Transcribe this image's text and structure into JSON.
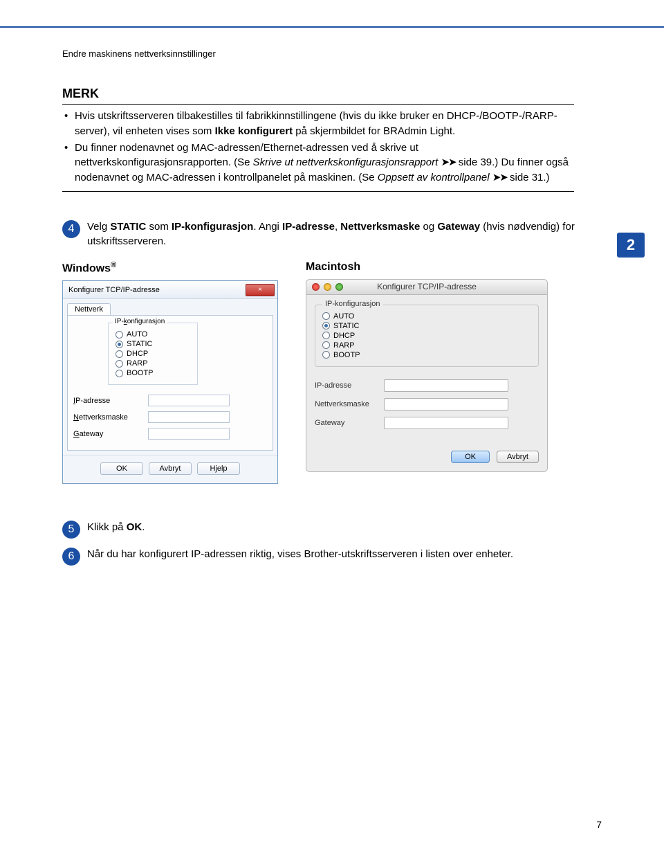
{
  "breadcrumb": "Endre maskinens nettverksinnstillinger",
  "chapter_badge": "2",
  "merk": {
    "title": "MERK",
    "bullet1_a": "Hvis utskriftsserveren tilbakestilles til fabrikkinnstillingene (hvis du ikke bruker en DHCP-/BOOTP-/RARP-server), vil enheten vises som ",
    "bullet1_b_bold": "Ikke konfigurert",
    "bullet1_c": " på skjermbildet for BRAdmin Light.",
    "bullet2_a": "Du finner nodenavnet og MAC-adressen/Ethernet-adressen ved å skrive ut nettverkskonfigurasjonsrapporten. (Se ",
    "bullet2_b_italic": "Skrive ut nettverkskonfigurasjonsrapport",
    "bullet2_c": " side 39.) Du finner også nodenavnet og MAC-adressen i kontrollpanelet på maskinen. (Se ",
    "bullet2_d_italic": "Oppsett av kontrollpanel",
    "bullet2_e": " side 31.)",
    "arrows": "➤➤"
  },
  "step4": {
    "num": "4",
    "a": "Velg ",
    "b_bold": "STATIC",
    "c": " som ",
    "d_bold": "IP-konfigurasjon",
    "e": ". Angi ",
    "f_bold": "IP-adresse",
    "g": ", ",
    "h_bold": "Nettverksmaske",
    "i": " og ",
    "j_bold": "Gateway",
    "k": " (hvis nødvendig) for utskriftsserveren."
  },
  "os_win_label": "Windows",
  "os_mac_label": "Macintosh",
  "win": {
    "title": "Konfigurer TCP/IP-adresse",
    "tab": "Nettverk",
    "group_legend": "IP-konfigurasjon",
    "opt_auto": "AUTO",
    "opt_static": "STATIC",
    "opt_dhcp": "DHCP",
    "opt_rarp": "RARP",
    "opt_bootp": "BOOTP",
    "ip_label_u": "I",
    "ip_label_rest": "P-adresse",
    "mask_label_u": "N",
    "mask_label_rest": "ettverksmaske",
    "gw_label_u": "G",
    "gw_label_rest": "ateway",
    "btn_ok": "OK",
    "btn_cancel": "Avbryt",
    "btn_help": "Hjelp",
    "close_x": "×"
  },
  "mac": {
    "title": "Konfigurer TCP/IP-adresse",
    "legend": "IP-konfigurasjon",
    "opt_auto": "AUTO",
    "opt_static": "STATIC",
    "opt_dhcp": "DHCP",
    "opt_rarp": "RARP",
    "opt_bootp": "BOOTP",
    "ip_label": "IP-adresse",
    "mask_label": "Nettverksmaske",
    "gw_label": "Gateway",
    "btn_ok": "OK",
    "btn_cancel": "Avbryt"
  },
  "step5": {
    "num": "5",
    "a": "Klikk på ",
    "b_bold": "OK",
    "c": "."
  },
  "step6": {
    "num": "6",
    "text": "Når du har konfigurert IP-adressen riktig, vises Brother-utskriftsserveren i listen over enheter."
  },
  "page_number": "7"
}
